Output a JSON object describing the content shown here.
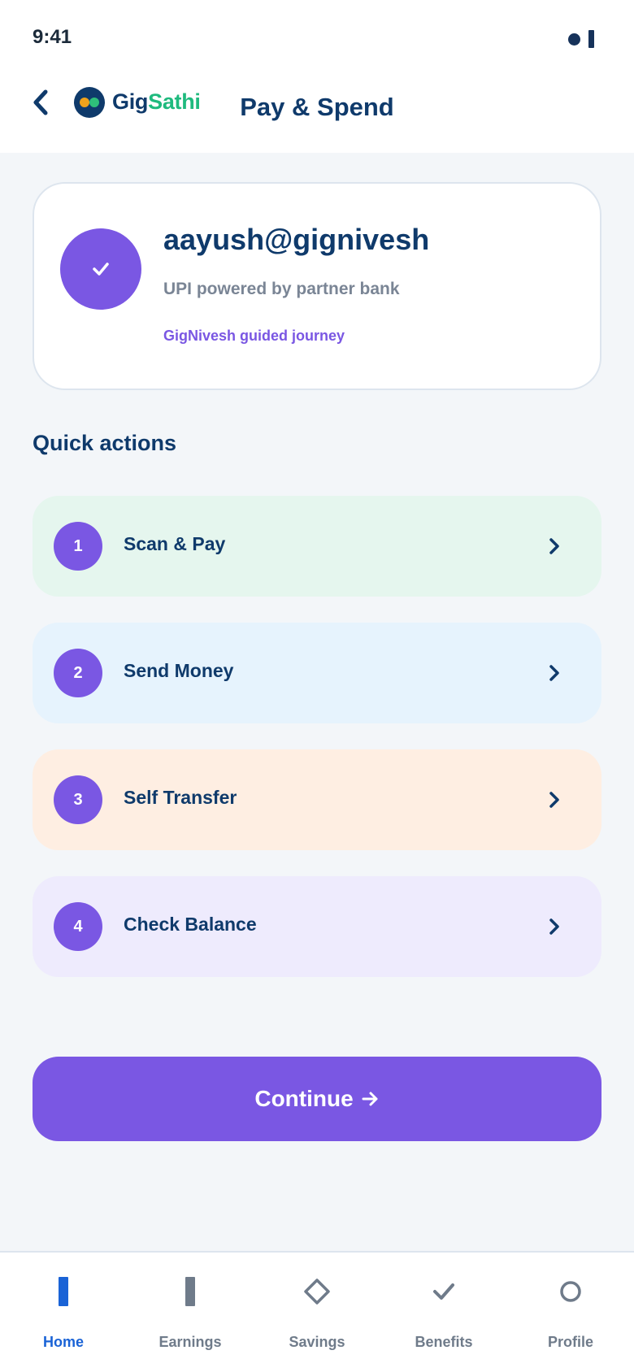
{
  "status_bar": {
    "time": "9:41"
  },
  "header": {
    "logo_part1": "Gig",
    "logo_part2": "Sathi",
    "title": "Pay & Spend"
  },
  "upi_card": {
    "upi_id": "aayush@gignivesh",
    "subtitle": "UPI powered by partner bank",
    "tag": "GigNivesh guided journey"
  },
  "quick_actions": {
    "title": "Quick actions",
    "items": [
      {
        "number": "1",
        "label": "Scan & Pay",
        "bg": "#e5f6ee"
      },
      {
        "number": "2",
        "label": "Send Money",
        "bg": "#e6f3fd"
      },
      {
        "number": "3",
        "label": "Self Transfer",
        "bg": "#feeee2"
      },
      {
        "number": "4",
        "label": "Check Balance",
        "bg": "#eeebfd"
      }
    ]
  },
  "continue_button": {
    "label": "Continue",
    "icon": "arrow-right-icon"
  },
  "bottom_nav": {
    "items": [
      {
        "label": "Home",
        "icon": "home-icon",
        "active": true
      },
      {
        "label": "Earnings",
        "icon": "earnings-icon",
        "active": false
      },
      {
        "label": "Savings",
        "icon": "diamond-icon",
        "active": false
      },
      {
        "label": "Benefits",
        "icon": "check-icon",
        "active": false
      },
      {
        "label": "Profile",
        "icon": "circle-icon",
        "active": false
      }
    ]
  },
  "colors": {
    "primary": "#7a57e3",
    "navy": "#0f3a6b",
    "active_nav": "#1a63d6",
    "brand_green": "#1fba7e"
  }
}
